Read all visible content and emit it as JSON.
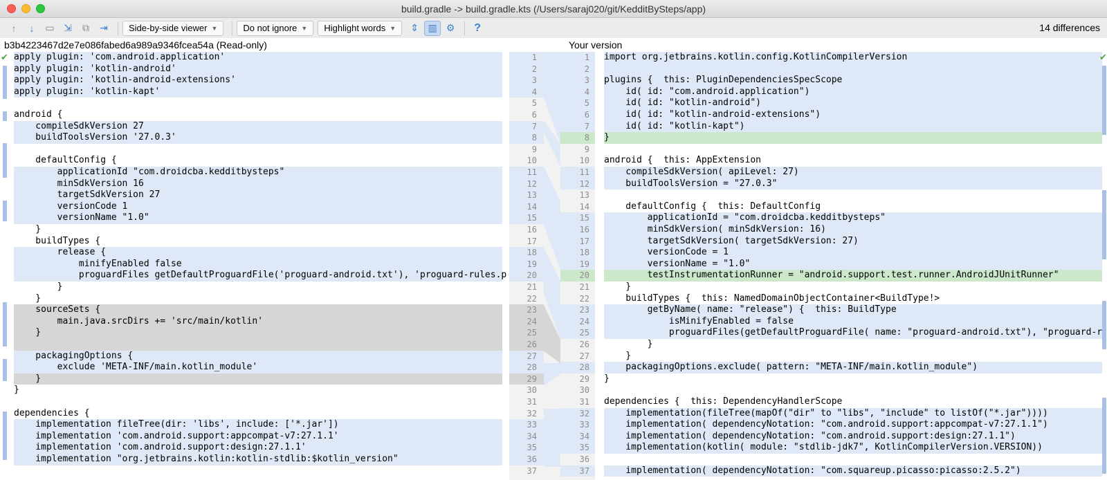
{
  "window": {
    "title": "build.gradle -> build.gradle.kts (/Users/saraj020/git/KedditBySteps/app)"
  },
  "toolbar": {
    "viewer": "Side-by-side viewer",
    "ignore": "Do not ignore",
    "highlight": "Highlight words",
    "differences": "14 differences",
    "help": "?"
  },
  "left": {
    "header": "b3b4223467d2e7e086fabed6a989a9346fcea54a (Read-only)"
  },
  "right": {
    "header": "Your version"
  },
  "colors": {
    "modified": "#dfe8f7",
    "deleted": "#d6d6d6",
    "added": "#cbe8cb"
  },
  "left_lines": [
    "apply plugin: 'com.android.application'",
    "apply plugin: 'kotlin-android'",
    "apply plugin: 'kotlin-android-extensions'",
    "apply plugin: 'kotlin-kapt'",
    "",
    "android {",
    "    compileSdkVersion 27",
    "    buildToolsVersion '27.0.3'",
    "",
    "    defaultConfig {",
    "        applicationId \"com.droidcba.kedditbysteps\"",
    "        minSdkVersion 16",
    "        targetSdkVersion 27",
    "        versionCode 1",
    "        versionName \"1.0\"",
    "    }",
    "    buildTypes {",
    "        release {",
    "            minifyEnabled false",
    "            proguardFiles getDefaultProguardFile('proguard-android.txt'), 'proguard-rules.p",
    "        }",
    "    }",
    "    sourceSets {",
    "        main.java.srcDirs += 'src/main/kotlin'",
    "    }",
    "",
    "    packagingOptions {",
    "        exclude 'META-INF/main.kotlin_module'",
    "    }",
    "}",
    "",
    "dependencies {",
    "    implementation fileTree(dir: 'libs', include: ['*.jar'])",
    "    implementation 'com.android.support:appcompat-v7:27.1.1'",
    "    implementation 'com.android.support:design:27.1.1'",
    "    implementation \"org.jetbrains.kotlin:kotlin-stdlib:$kotlin_version\""
  ],
  "right_lines": [
    "import org.jetbrains.kotlin.config.KotlinCompilerVersion",
    "",
    "plugins {  this: PluginDependenciesSpecScope",
    "    id( id: \"com.android.application\")",
    "    id( id: \"kotlin-android\")",
    "    id( id: \"kotlin-android-extensions\")",
    "    id( id: \"kotlin-kapt\")",
    "}",
    "",
    "android {  this: AppExtension",
    "    compileSdkVersion( apiLevel: 27)",
    "    buildToolsVersion = \"27.0.3\"",
    "",
    "    defaultConfig {  this: DefaultConfig",
    "        applicationId = \"com.droidcba.kedditbysteps\"",
    "        minSdkVersion( minSdkVersion: 16)",
    "        targetSdkVersion( targetSdkVersion: 27)",
    "        versionCode = 1",
    "        versionName = \"1.0\"",
    "        testInstrumentationRunner = \"android.support.test.runner.AndroidJUnitRunner\"",
    "    }",
    "    buildTypes {  this: NamedDomainObjectContainer<BuildType!>",
    "        getByName( name: \"release\") {  this: BuildType",
    "            isMinifyEnabled = false",
    "            proguardFiles(getDefaultProguardFile( name: \"proguard-android.txt\"), \"proguard-r",
    "        }",
    "    }",
    "    packagingOptions.exclude( pattern: \"META-INF/main.kotlin_module\")",
    "}",
    "",
    "dependencies {  this: DependencyHandlerScope",
    "    implementation(fileTree(mapOf(\"dir\" to \"libs\", \"include\" to listOf(\"*.jar\"))))",
    "    implementation( dependencyNotation: \"com.android.support:appcompat-v7:27.1.1\")",
    "    implementation( dependencyNotation: \"com.android.support:design:27.1.1\")",
    "    implementation(kotlin( module: \"stdlib-jdk7\", KotlinCompilerVersion.VERSION))",
    "",
    "    implementation( dependencyNotation: \"com.squareup.picasso:picasso:2.5.2\")"
  ],
  "gutter": {
    "left_numbers": [
      "1",
      "2",
      "3",
      "4",
      "5",
      "6",
      "7",
      "8",
      "9",
      "10",
      "11",
      "12",
      "13",
      "14",
      "15",
      "16",
      "17",
      "18",
      "19",
      "20",
      "21",
      "22",
      "23",
      "24",
      "25",
      "26",
      "27",
      "28",
      "29",
      "30",
      "31",
      "32",
      "33",
      "34",
      "35",
      "36",
      "37"
    ],
    "right_numbers": [
      "1",
      "2",
      "3",
      "4",
      "5",
      "6",
      "7",
      "8",
      "9",
      "10",
      "11",
      "12",
      "13",
      "14",
      "15",
      "16",
      "17",
      "18",
      "19",
      "20",
      "21",
      "22",
      "23",
      "24",
      "25",
      "26",
      "27",
      "28",
      "29",
      "30",
      "31",
      "32",
      "33",
      "34",
      "35",
      "36",
      "37"
    ]
  }
}
